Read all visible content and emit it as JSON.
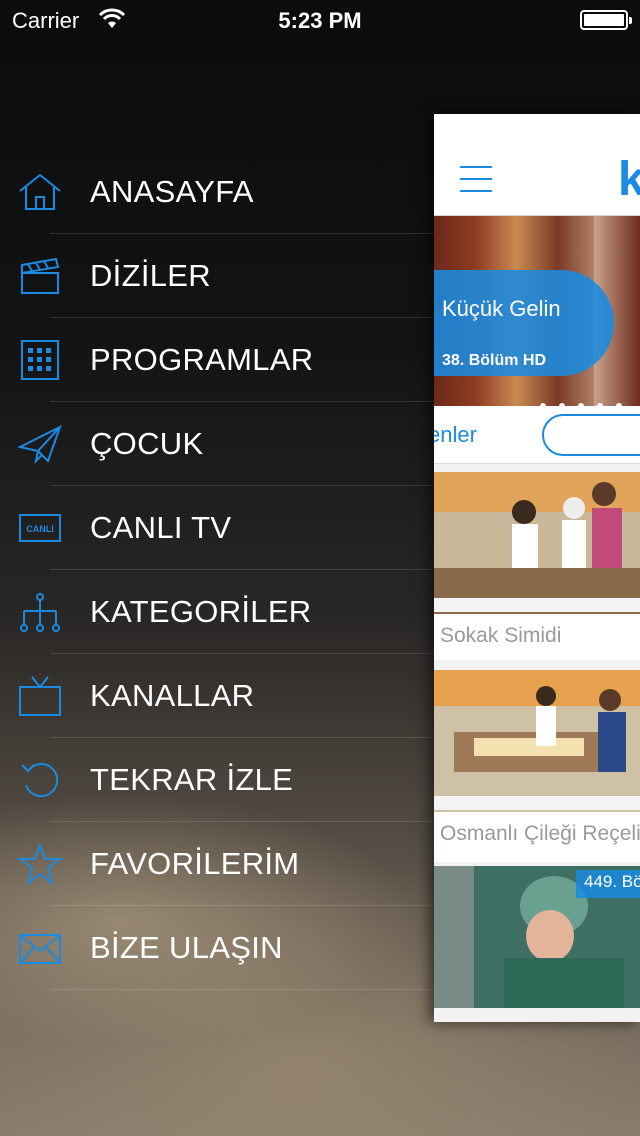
{
  "status_bar": {
    "carrier": "Carrier",
    "time": "5:23 PM",
    "battery_level": 1.0
  },
  "menu": {
    "items": [
      {
        "label": "ANASAYFA",
        "icon": "home-icon"
      },
      {
        "label": "DİZİLER",
        "icon": "clapperboard-icon"
      },
      {
        "label": "PROGRAMLAR",
        "icon": "grid-icon"
      },
      {
        "label": "ÇOCUK",
        "icon": "paper-plane-icon"
      },
      {
        "label": "CANLI TV",
        "icon": "live-tv-icon"
      },
      {
        "label": "KATEGORİLER",
        "icon": "hierarchy-icon"
      },
      {
        "label": "KANALLAR",
        "icon": "tv-icon"
      },
      {
        "label": "TEKRAR İZLE",
        "icon": "replay-icon"
      },
      {
        "label": "FAVORİLERİM",
        "icon": "star-icon"
      },
      {
        "label": "BİZE ULAŞIN",
        "icon": "envelope-icon"
      }
    ],
    "live_icon_text": "CANLI"
  },
  "panel": {
    "logo_text": "k",
    "hero": {
      "title": "Küçük Gelin",
      "subtitle": "38. Bölüm HD"
    },
    "tab_text": "enler",
    "cards": [
      {
        "title": "Sokak Simidi"
      },
      {
        "title": "Osmanlı Çileği Reçeli"
      },
      {
        "badge": "449. Bö"
      }
    ]
  },
  "colors": {
    "accent": "#1a8be0"
  }
}
